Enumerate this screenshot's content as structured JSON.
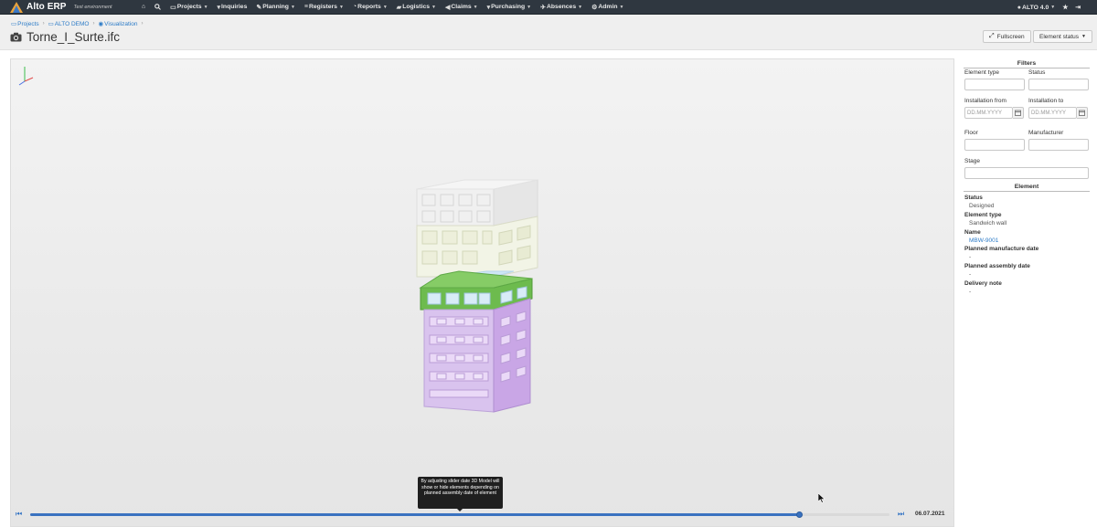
{
  "app": {
    "brand": "Alto ERP",
    "environment": "Test environment"
  },
  "nav": {
    "items": [
      {
        "label": "Projects",
        "icon": "folder-icon"
      },
      {
        "label": "Inquiries",
        "icon": "cart-icon"
      },
      {
        "label": "Planning",
        "icon": "wrench-icon"
      },
      {
        "label": "Registers",
        "icon": "list-icon"
      },
      {
        "label": "Reports",
        "icon": "chart-icon"
      },
      {
        "label": "Logistics",
        "icon": "truck-icon"
      },
      {
        "label": "Claims",
        "icon": "megaphone-icon"
      },
      {
        "label": "Purchasing",
        "icon": "cart-icon"
      },
      {
        "label": "Absences",
        "icon": "plane-icon"
      },
      {
        "label": "Admin",
        "icon": "gear-icon"
      }
    ],
    "user": "ALTO 4.0"
  },
  "breadcrumb": {
    "items": [
      "Projects",
      "ALTO DEMO",
      "Visualization"
    ]
  },
  "page": {
    "title": "Torne_I_Surte.ifc",
    "fullscreen_label": "Fullscreen",
    "element_status_label": "Element status"
  },
  "filters": {
    "title": "Filters",
    "element_type_label": "Element type",
    "status_label": "Status",
    "installation_from_label": "Installation from",
    "installation_to_label": "Installation to",
    "date_placeholder": "DD.MM.YYYY",
    "floor_label": "Floor",
    "manufacturer_label": "Manufacturer",
    "stage_label": "Stage"
  },
  "element": {
    "title": "Element",
    "status_label": "Status",
    "status_value": "Designed",
    "type_label": "Element type",
    "type_value": "Sandwich wall",
    "name_label": "Name",
    "name_value": "MBW-9001",
    "planned_manufacture_label": "Planned manufacture date",
    "planned_manufacture_value": "-",
    "planned_assembly_label": "Planned assembly date",
    "planned_assembly_value": "-",
    "delivery_note_label": "Delivery note",
    "delivery_note_value": "-"
  },
  "timeline": {
    "date": "06.07.2021",
    "progress": 0.896,
    "tooltip": "By adjusting slider date 3D Model will show or hide elements depending on planned assembly date of element"
  },
  "colors": {
    "nav_bg": "#2f3740",
    "link": "#2c7bc7",
    "slider": "#3a72c0",
    "assembled": "#c9a6e6",
    "in_progress": "#6dbb4e"
  }
}
